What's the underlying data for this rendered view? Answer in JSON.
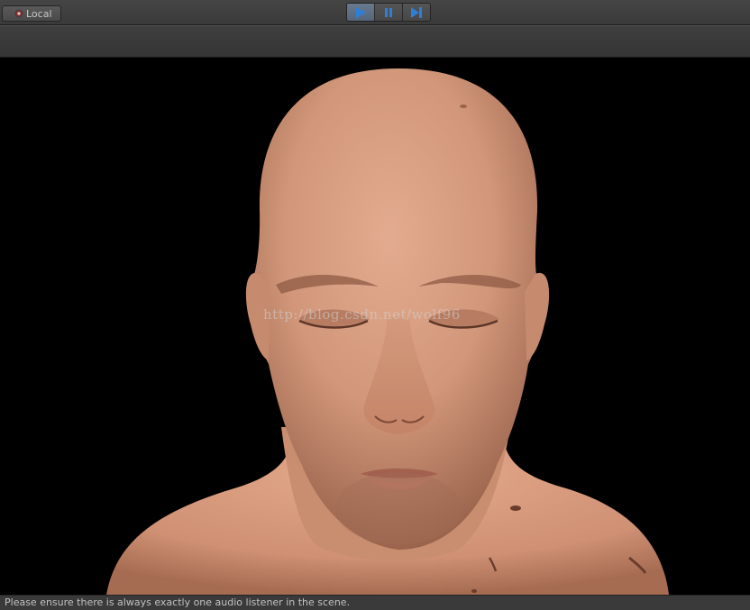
{
  "toolbar": {
    "pivot_label": "Local",
    "play_buttons": [
      "play-icon",
      "pause-icon",
      "step-icon"
    ],
    "accent_color": "#2f7fd6"
  },
  "viewport": {
    "watermark_text": "http://blog.csdn.net/wolf96"
  },
  "status": {
    "message": "Please ensure there is always exactly one audio listener in the scene."
  }
}
